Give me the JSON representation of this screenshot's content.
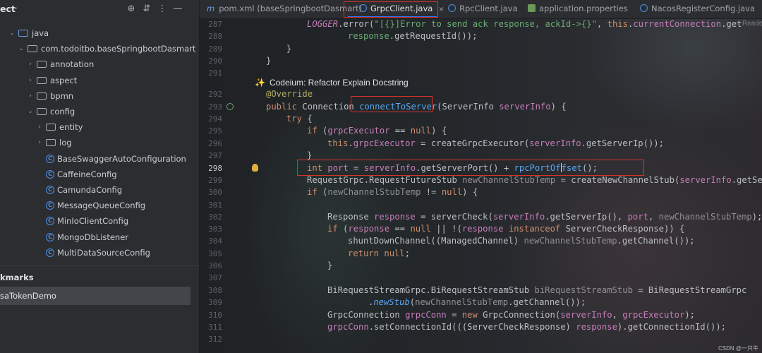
{
  "sidebar": {
    "title": "ect",
    "items": [
      {
        "label": "java",
        "kind": "folder-blue",
        "depth": 1,
        "arrow": "open"
      },
      {
        "label": "com.todoitbo.baseSpringbootDasmart",
        "kind": "folder",
        "depth": 2,
        "arrow": "open"
      },
      {
        "label": "annotation",
        "kind": "folder",
        "depth": 3,
        "arrow": "closed"
      },
      {
        "label": "aspect",
        "kind": "folder",
        "depth": 3,
        "arrow": "closed"
      },
      {
        "label": "bpmn",
        "kind": "folder",
        "depth": 3,
        "arrow": "closed"
      },
      {
        "label": "config",
        "kind": "folder",
        "depth": 3,
        "arrow": "open"
      },
      {
        "label": "entity",
        "kind": "folder",
        "depth": 4,
        "arrow": "closed"
      },
      {
        "label": "log",
        "kind": "folder",
        "depth": 4,
        "arrow": "closed"
      },
      {
        "label": "BaseSwaggerAutoConfiguration",
        "kind": "class",
        "depth": 4
      },
      {
        "label": "CaffeineConfig",
        "kind": "class",
        "depth": 4
      },
      {
        "label": "CamundaConfig",
        "kind": "class",
        "depth": 4
      },
      {
        "label": "MessageQueueConfig",
        "kind": "class",
        "depth": 4
      },
      {
        "label": "MinIoClientConfig",
        "kind": "class",
        "depth": 4
      },
      {
        "label": "MongoDbListener",
        "kind": "class",
        "depth": 4
      },
      {
        "label": "MultiDataSourceConfig",
        "kind": "class",
        "depth": 4
      }
    ],
    "bookmarks_title": "kmarks",
    "bookmark_item": "saTokenDemo"
  },
  "tabs": [
    {
      "label": "pom.xml (baseSpringbootDasmart)",
      "icon": "maven-icon"
    },
    {
      "label": "GrpcClient.java",
      "icon": "class-icon",
      "active": true,
      "close": "×"
    },
    {
      "label": "RpcClient.java",
      "icon": "class-icon"
    },
    {
      "label": "application.properties",
      "icon": "properties-icon"
    },
    {
      "label": "NacosRegisterConfig.java",
      "icon": "class-icon"
    }
  ],
  "editor": {
    "reader_mode": "Reader",
    "codeium_hint": "Codeium: Refactor Explain Docstring",
    "current_line": "298",
    "line_numbers": [
      "287",
      "288",
      "289",
      "290",
      "291",
      "292",
      "293",
      "294",
      "295",
      "296",
      "297",
      "298",
      "299",
      "300",
      "301",
      "302",
      "303",
      "304",
      "305",
      "306",
      "307",
      "308",
      "309",
      "310",
      "311",
      "312"
    ]
  },
  "watermark": "CSDN @一只牛博",
  "colors": {
    "keyword": "#cf8e6d",
    "function": "#56a8f5",
    "string": "#6aab73",
    "annotation": "#b3ae60",
    "field": "#c77dbb",
    "highlight_box": "#d8322a",
    "accent": "#3574f0"
  }
}
